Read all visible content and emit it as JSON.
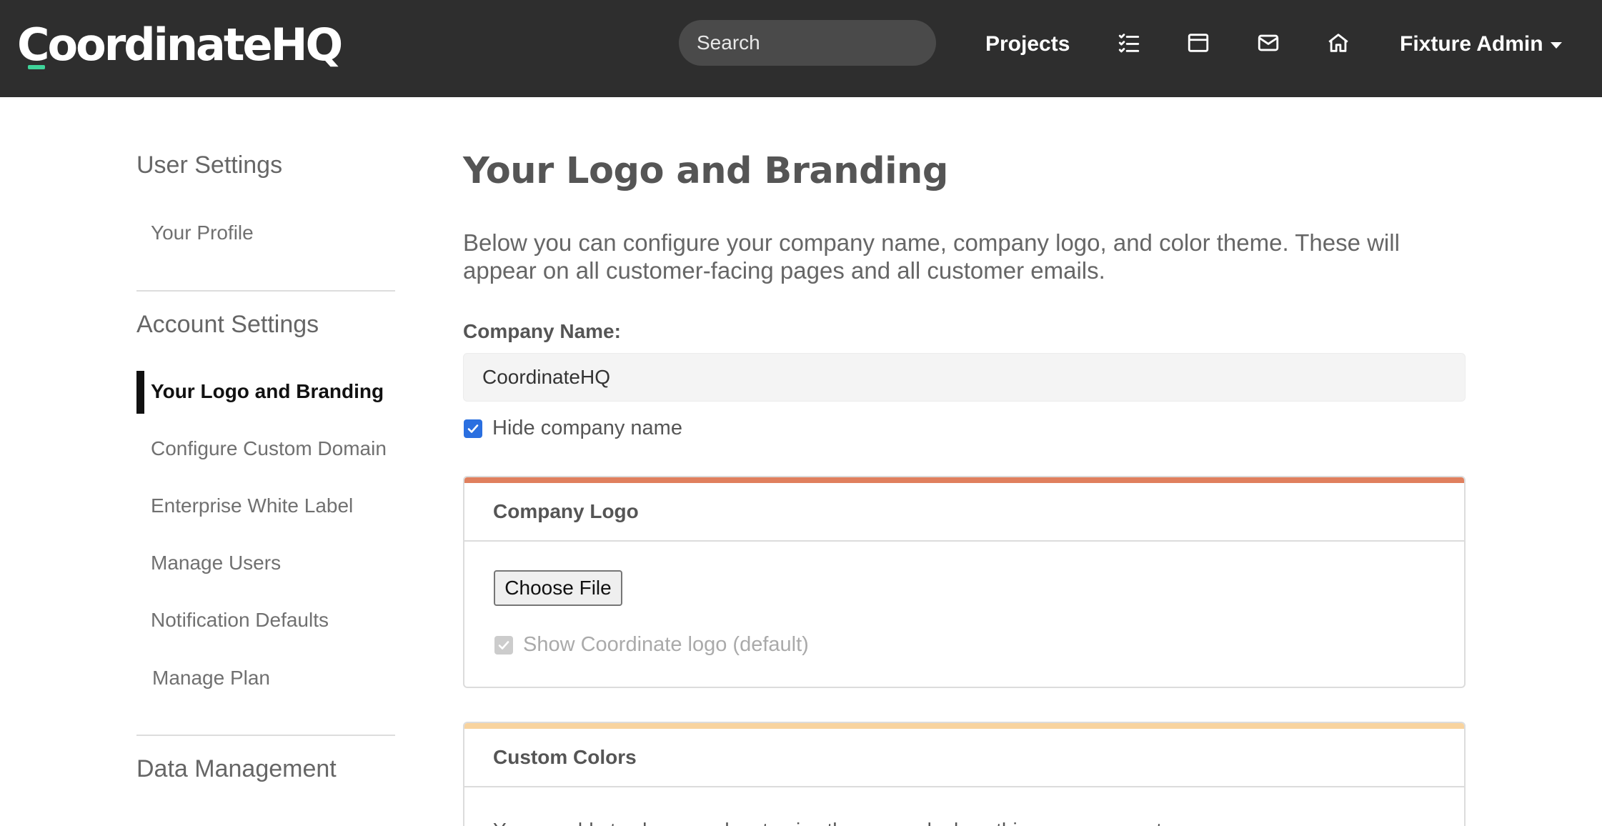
{
  "nav": {
    "logo_text": "CoordinateHQ",
    "search_placeholder": "Search",
    "projects_label": "Projects",
    "user_label": "Fixture Admin",
    "icons": [
      "checklist-icon",
      "calendar-window-icon",
      "mail-icon",
      "home-icon"
    ]
  },
  "sidebar": {
    "user_settings_heading": "User Settings",
    "user_items": [
      "Your Profile"
    ],
    "account_settings_heading": "Account Settings",
    "account_items": [
      "Your Logo and Branding",
      "Configure Custom Domain",
      "Enterprise White Label",
      "Manage Users",
      "Notification Defaults",
      "Manage Plan"
    ],
    "active_item": "Your Logo and Branding",
    "data_management_heading": "Data Management"
  },
  "main": {
    "title": "Your Logo and Branding",
    "intro": "Below you can configure your company name, company logo, and color theme. These will appear on all customer-facing pages and all customer emails.",
    "company_name_label": "Company Name:",
    "company_name_value": "CoordinateHQ",
    "hide_name_label": "Hide company name",
    "hide_name_checked": true,
    "logo_card": {
      "title": "Company Logo",
      "choose_file_label": "Choose File",
      "show_default_logo_label": "Show Coordinate logo (default)",
      "show_default_logo_checked": true,
      "show_default_logo_disabled": true
    },
    "colors_card": {
      "title": "Custom Colors",
      "body_text": "You are able to change colors to give the page a look as this company wants."
    }
  },
  "colors": {
    "nav_bg": "#2e2e2e",
    "logo_accent": "#3fd49a",
    "logo_card_accent": "#e0805e",
    "colors_card_accent": "#f8d39e",
    "checkbox_blue": "#2a6fe0"
  }
}
